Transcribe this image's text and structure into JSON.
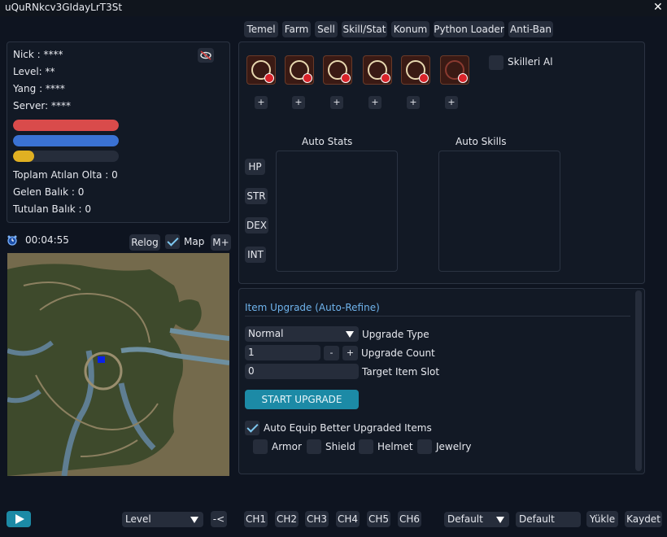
{
  "window": {
    "title": "uQuRNkcv3GIdayLrT3St"
  },
  "tabs": [
    "Temel",
    "Farm",
    "Sell",
    "Skill/Stat",
    "Konum",
    "Python Loader",
    "Anti-Ban"
  ],
  "info": {
    "nick": "Nick : ****",
    "level": "Level: **",
    "yang": "Yang : ****",
    "server": "Server: ****",
    "olta": "Toplam Atılan Olta : 0",
    "gelen": "Gelen Balık : 0",
    "tutulan": "Tutulan Balık : 0"
  },
  "bars": {
    "hp": 1.0,
    "mp": 1.0,
    "exp": 0.2,
    "hp_color": "#d94b4b",
    "mp_color": "#3a72d4",
    "exp_color": "#e0b022"
  },
  "timer": "00:04:55",
  "map_bar": {
    "relog": "Relog",
    "map": "Map",
    "mplus": "M+"
  },
  "skills": {
    "checkbox": "Skilleri Al",
    "plus": "+"
  },
  "stats": {
    "auto_stats": "Auto Stats",
    "auto_skills": "Auto Skills",
    "hp": "HP",
    "str": "STR",
    "dex": "DEX",
    "int": "INT"
  },
  "upgrade": {
    "header": "Item Upgrade (Auto-Refine)",
    "type_value": "Normal",
    "type_label": "Upgrade Type",
    "count_value": "1",
    "minus": "-",
    "plus": "+",
    "count_label": "Upgrade Count",
    "slot_value": "0",
    "slot_label": "Target Item Slot",
    "start": "START UPGRADE",
    "auto_equip": "Auto Equip Better Upgraded Items",
    "armor": "Armor",
    "shield": "Shield",
    "helmet": "Helmet",
    "jewelry": "Jewelry"
  },
  "bottom": {
    "level": "Level",
    "back": "-<",
    "ch": [
      "CH1",
      "CH2",
      "CH3",
      "CH4",
      "CH5",
      "CH6"
    ],
    "profile": "Default",
    "profile_name": "Default",
    "load": "Yükle",
    "save": "Kaydet"
  }
}
